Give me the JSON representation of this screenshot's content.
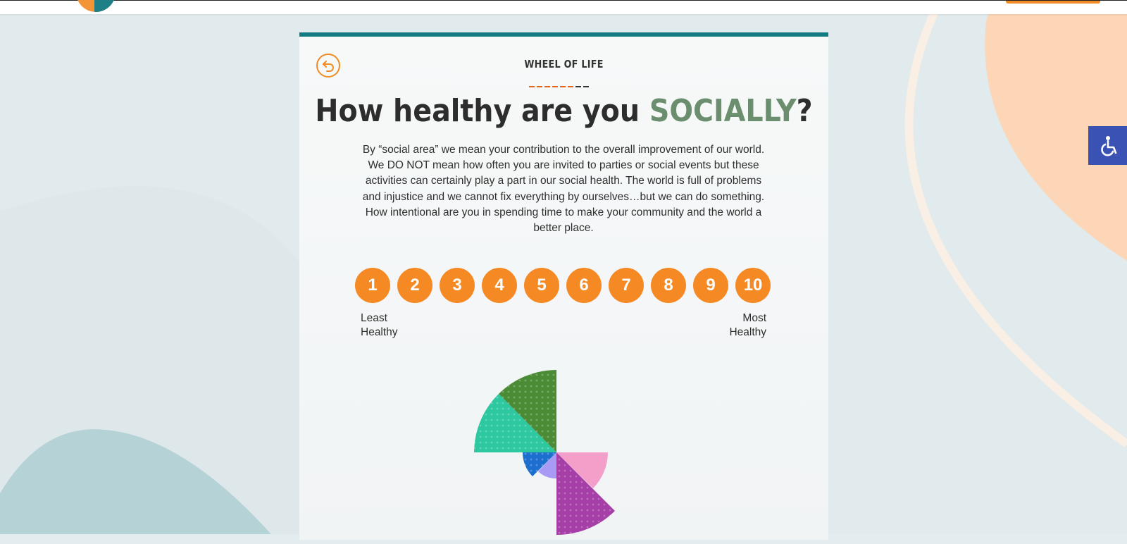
{
  "header": {
    "logo": "wheel-logo",
    "colors": {
      "logo_orange": "#f39437",
      "logo_teal": "#1f7f86",
      "button": "#f08a24"
    }
  },
  "card": {
    "eyebrow": "WHEEL OF LIFE",
    "title_prefix": "How healthy are you ",
    "title_accent": "SOCIALLY",
    "title_suffix": "?",
    "description": "By “social area” we mean your contribution to the overall improvement of our world. We DO NOT mean how often you are invited to parties or social events but these activities can certainly play a part in our social health. The world is full of problems and injustice and we cannot fix everything by ourselves…but we can do something. How intentional are you in spending time to make your community and the world a better place.",
    "scale": [
      "1",
      "2",
      "3",
      "4",
      "5",
      "6",
      "7",
      "8",
      "9",
      "10"
    ],
    "least_label": "Least Healthy",
    "most_label": "Most Healthy",
    "colors": {
      "top_border": "#137b81",
      "accent": "#6b8e6f",
      "scale_button": "#f58a24"
    }
  },
  "wheel": {
    "segments": [
      {
        "color": "#4b8b36"
      },
      {
        "color": "#f49fc9"
      },
      {
        "color": "#a53ea7"
      },
      {
        "color": "#a99af5"
      },
      {
        "color": "#1d6fcf"
      },
      {
        "color": "#2dc8a0"
      }
    ]
  },
  "accessibility": {
    "icon": "wheelchair-icon",
    "color": "#3b52b5"
  }
}
